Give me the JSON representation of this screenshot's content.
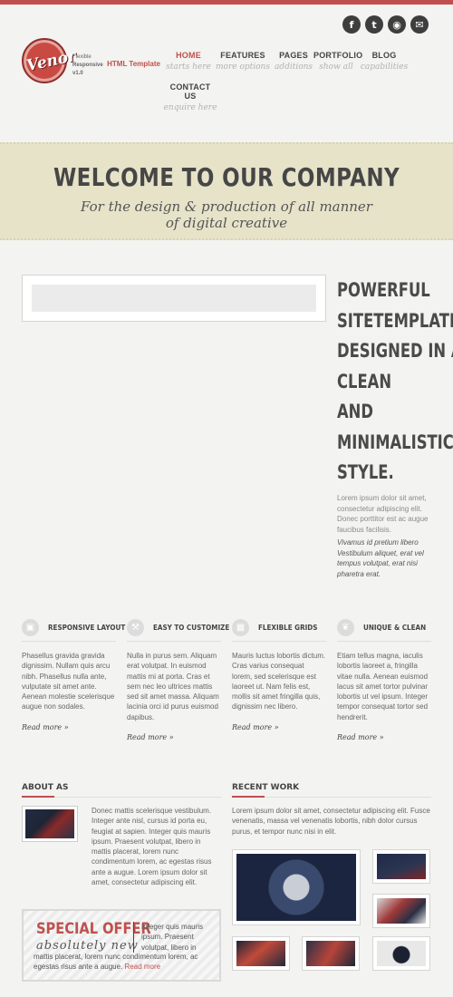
{
  "social": [
    {
      "name": "facebook-icon",
      "glyph": "f"
    },
    {
      "name": "twitter-icon",
      "glyph": "t"
    },
    {
      "name": "rss-icon",
      "glyph": "◉"
    },
    {
      "name": "email-icon",
      "glyph": "✉"
    }
  ],
  "logo": {
    "text": "Venor",
    "tag_small": "Flexible",
    "tag_responsive": "Responsive",
    "tag_html": "HTML Template",
    "tag_version": "v1.0"
  },
  "nav": [
    {
      "label": "HOME",
      "sub": "starts here"
    },
    {
      "label": "FEATURES",
      "sub": "more options"
    },
    {
      "label": "PAGES",
      "sub": "additions"
    },
    {
      "label": "PORTFOLIO",
      "sub": "show all"
    },
    {
      "label": "BLOG",
      "sub": "capabilities"
    },
    {
      "label": "CONTACT US",
      "sub": "enquire here"
    }
  ],
  "hero": {
    "title": "WELCOME TO OUR COMPANY",
    "subtitle_line1": "For the design & production of all manner",
    "subtitle_line2": "of digital creative"
  },
  "intro": {
    "headline": [
      "POWERFUL",
      "SITETEMPLATE",
      "DESIGNED IN A",
      "CLEAN",
      "AND",
      "MINIMALISTIC",
      "STYLE."
    ],
    "para1": "Lorem ipsum dolor sit amet, consectetur adipiscing elit. Donec porttitor est ac augue faucibus facilisis.",
    "para2": "Vivamus id pretium libero Vestibulum aliquet, erat vel tempus volutpat, erat nisi pharetra erat."
  },
  "features": [
    {
      "icon": "layout-icon",
      "glyph": "▣",
      "title": "RESPONSIVE LAYOUT",
      "text": "Phasellus gravida gravida dignissim. Nullam quis arcu nibh. Phasellus nulla ante, vulputate sit amet ante. Aenean molestie scelerisque augue non sodales.",
      "more": "Read more »"
    },
    {
      "icon": "customize-icon",
      "glyph": "⚒",
      "title": "EASY TO CUSTOMIZE",
      "text": "Nulla in purus sem. Aliquam erat volutpat. In euismod mattis mi at porta. Cras et sem nec leo ultrices mattis sed sit amet massa. Aliquam lacinia orci id purus euismod dapibus.",
      "more": "Read more »"
    },
    {
      "icon": "grid-icon",
      "glyph": "▦",
      "title": "FLEXIBLE GRIDS",
      "text": "Mauris luctus lobortis dictum. Cras varius consequat lorem, sed scelerisque est laoreet ut. Nam felis est, mollis sit amet fringilla quis, dignissim nec libero.",
      "more": "Read more »"
    },
    {
      "icon": "leaf-icon",
      "glyph": "❦",
      "title": "UNIQUE & CLEAN",
      "text": "Etiam tellus magna, iaculis lobortis laoreet a, fringilla vitae nulla. Aenean euismod lacus sit amet tortor pulvinar lobortis ut vel ipsum. Integer tempor consequat tortor sed hendrerit.",
      "more": "Read more »"
    }
  ],
  "about": {
    "title": "ABOUT AS",
    "text": "Donec mattis scelerisque vestibulum. Integer ante nisl, cursus id porta eu, feugiat at sapien. Integer quis mauris ipsum. Praesent volutpat, libero in mattis placerat, lorem nunc condimentum lorem, ac egestas risus ante a augue. Lorem ipsum dolor sit amet, consectetur adipiscing elit."
  },
  "special": {
    "title": "SPECIAL OFFER",
    "subtitle": "absolutely new",
    "text_right": "Integer quis mauris ipsum. Praesent volutpat, libero in",
    "text_bottom": "mattis placerat, lorem nunc condimentum lorem, ac egestas risus ante a augue.",
    "more": "Read more"
  },
  "recent": {
    "title": "RECENT WORK",
    "text": "Lorem ipsum dolor sit amet, consectetur adipiscing elit. Fusce venenatis, massa vel venenatis lobortis, nibh dolor cursus purus, et tempor nunc nisi in elit."
  },
  "colors": {
    "accent": "#c0504d",
    "hero_band": "#e6e3c9",
    "background": "#f3f3f1"
  }
}
